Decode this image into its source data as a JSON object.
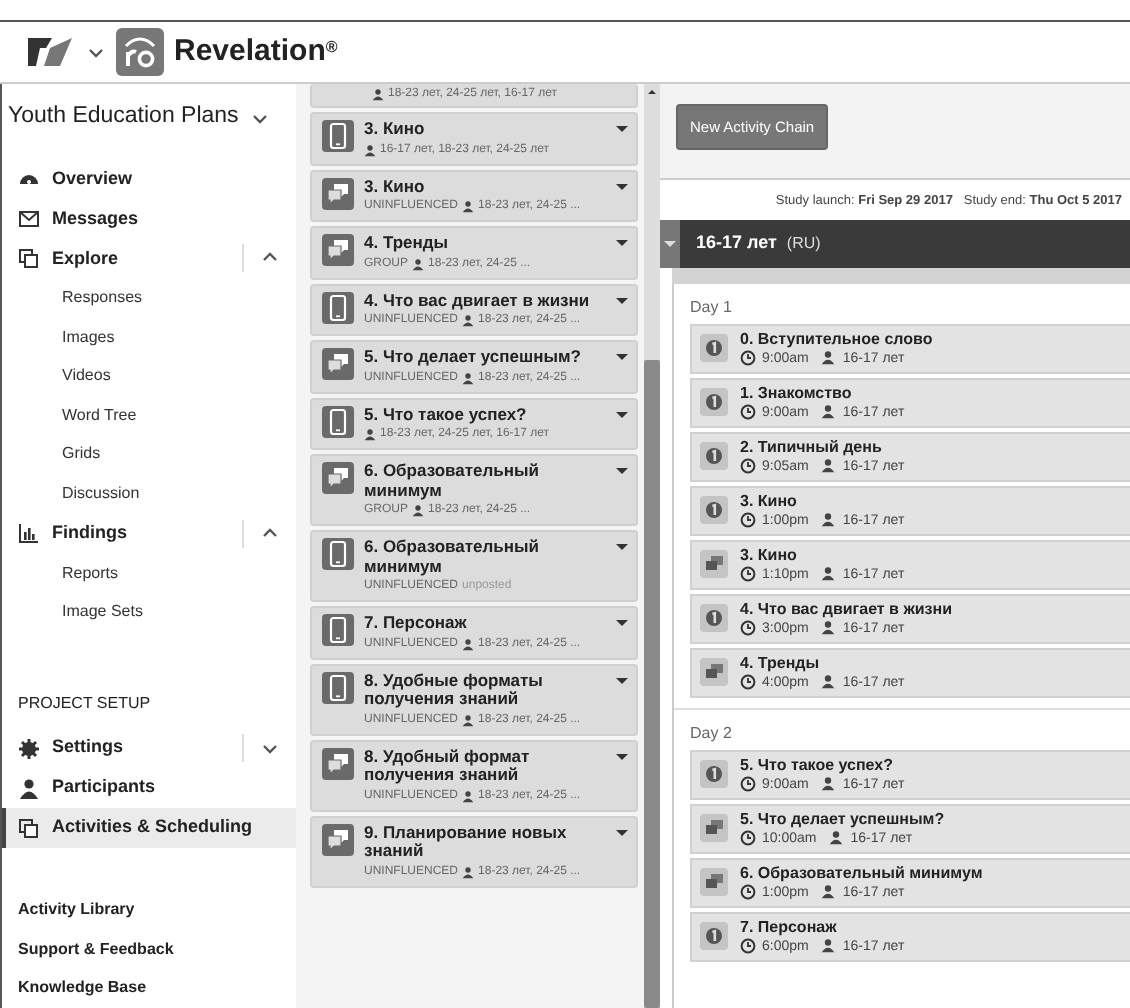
{
  "header": {
    "brand": "Revelation$^{®}$"
  },
  "project": {
    "title": "Youth Education Plans"
  },
  "nav": [
    {
      "label": "Overview",
      "kind": "link",
      "selected": false
    },
    {
      "label": "Messages",
      "kind": "link",
      "selected": false
    },
    {
      "label": "Explore",
      "kind": "group",
      "expanded": true,
      "selected": false,
      "children": [
        {
          "label": "Responses"
        },
        {
          "label": "Images"
        },
        {
          "label": "Videos"
        },
        {
          "label": "Word Tree"
        },
        {
          "label": "Grids"
        },
        {
          "label": "Discussion"
        }
      ]
    },
    {
      "label": "Findings",
      "kind": "group",
      "expanded": true,
      "selected": false,
      "children": [
        {
          "label": "Reports"
        },
        {
          "label": "Image Sets"
        }
      ]
    }
  ],
  "setup": {
    "heading": "PROJECT SETUP",
    "items": [
      {
        "label": "Settings",
        "kind": "group",
        "expanded": false,
        "selected": false
      },
      {
        "label": "Participants",
        "kind": "link",
        "selected": false
      },
      {
        "label": "Activities & Scheduling",
        "kind": "link",
        "selected": true
      }
    ]
  },
  "footer_links": [
    "Activity Library",
    "Support & Feedback",
    "Knowledge Base"
  ],
  "activities": [
    {
      "kind": "partial",
      "groups": "18-23 лет, 24-25 лет, 16-17 лет"
    },
    {
      "kind": "mobile",
      "title": "3. Кино",
      "groups": "16-17 лет, 18-23 лет, 24-25 лет"
    },
    {
      "kind": "discussion",
      "title": "3. Кино",
      "tag": "UNINFLUENCED",
      "groups": "18-23 лет, 24-25 ..."
    },
    {
      "kind": "discussion",
      "title": "4. Тренды",
      "tag": "GROUP",
      "groups": "18-23 лет, 24-25 ..."
    },
    {
      "kind": "mobile",
      "title": "4. Что вас двигает в жизни",
      "tag": "UNINFLUENCED",
      "groups": "18-23 лет, 24-25 ..."
    },
    {
      "kind": "discussion",
      "title": "5. Что делает успешным?",
      "tag": "UNINFLUENCED",
      "groups": "18-23 лет, 24-25 ..."
    },
    {
      "kind": "mobile",
      "title": "5. Что такое успех?",
      "groups": "18-23 лет, 24-25 лет, 16-17 лет"
    },
    {
      "kind": "discussion",
      "title": "6. Образовательный минимум",
      "tag": "GROUP",
      "groups": "18-23 лет, 24-25 ..."
    },
    {
      "kind": "mobile",
      "title": "6. Образовательный минимум",
      "tag": "UNINFLUENCED",
      "status": "unposted"
    },
    {
      "kind": "mobile",
      "title": "7. Персонаж",
      "tag": "UNINFLUENCED",
      "groups": "18-23 лет, 24-25 ..."
    },
    {
      "kind": "mobile",
      "title": "8. Удобные форматы получения знаний",
      "tag": "UNINFLUENCED",
      "groups": "18-23 лет, 24-25 ..."
    },
    {
      "kind": "discussion",
      "title": "8. Удобный формат получения знаний",
      "tag": "UNINFLUENCED",
      "groups": "18-23 лет, 24-25 ..."
    },
    {
      "kind": "discussion",
      "title": "9. Планирование новых знаний",
      "tag": "UNINFLUENCED",
      "groups": "18-23 лет, 24-25 ..."
    }
  ],
  "schedule": {
    "button": "New Activity Chain",
    "study_dates": "Study launch: **Fri Sep 29 2017**   Study end: **Thu Oct 5 2017**",
    "segment": {
      "name": "16-17 лет",
      "locale": "(RU)",
      "expanded": true
    },
    "days": [
      {
        "label": "Day 1",
        "items": [
          {
            "kind": "mobile",
            "title": "0. Вступительное слово",
            "time": "9:00am",
            "group": "16-17 лет"
          },
          {
            "kind": "mobile",
            "title": "1. Знакомство",
            "time": "9:00am",
            "group": "16-17 лет"
          },
          {
            "kind": "mobile",
            "title": "2. Типичный день",
            "time": "9:05am",
            "group": "16-17 лет"
          },
          {
            "kind": "mobile",
            "title": "3. Кино",
            "time": "1:00pm",
            "group": "16-17 лет"
          },
          {
            "kind": "discussion",
            "title": "3. Кино",
            "time": "1:10pm",
            "group": "16-17 лет"
          },
          {
            "kind": "mobile",
            "title": "4. Что вас двигает в жизни",
            "time": "3:00pm",
            "group": "16-17 лет"
          },
          {
            "kind": "discussion",
            "title": "4. Тренды",
            "time": "4:00pm",
            "group": "16-17 лет"
          }
        ]
      },
      {
        "label": "Day 2",
        "items": [
          {
            "kind": "mobile",
            "title": "5. Что такое успех?",
            "time": "9:00am",
            "group": "16-17 лет"
          },
          {
            "kind": "discussion",
            "title": "5. Что делает успешным?",
            "time": "10:00am",
            "group": "16-17 лет"
          },
          {
            "kind": "discussion",
            "title": "6. Образовательный минимум",
            "time": "1:00pm",
            "group": "16-17 лет"
          },
          {
            "kind": "mobile",
            "title": "7. Персонаж",
            "time": "6:00pm",
            "group": "16-17 лет"
          }
        ]
      }
    ]
  }
}
